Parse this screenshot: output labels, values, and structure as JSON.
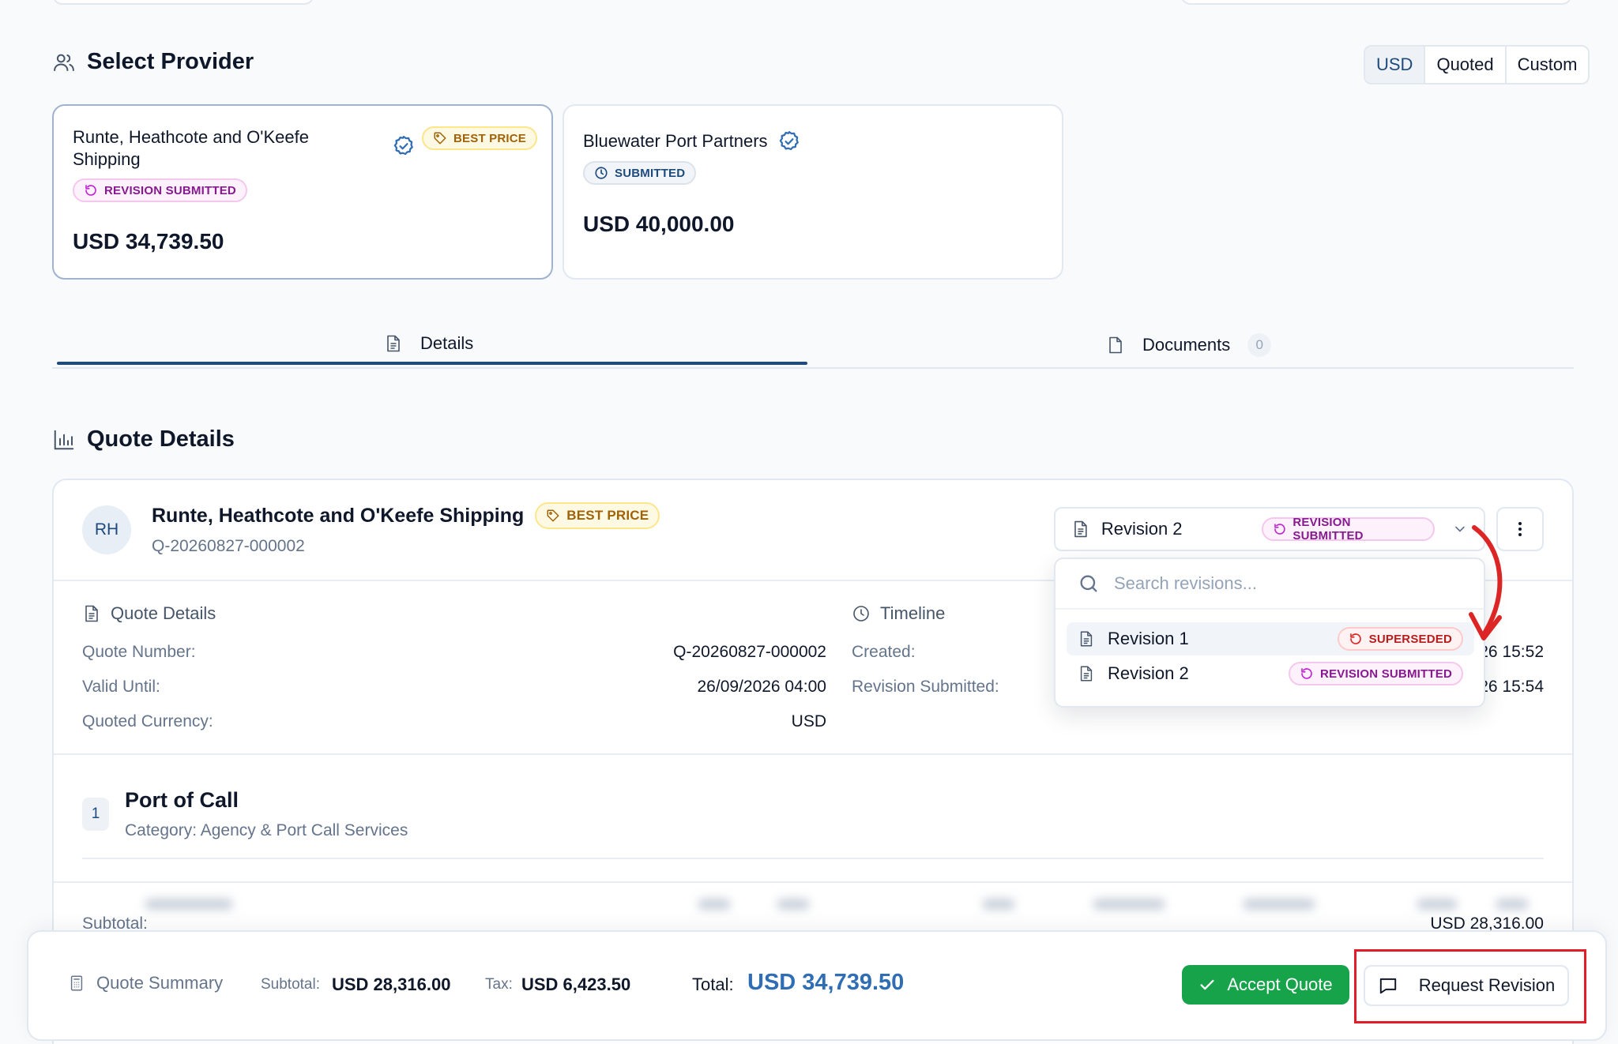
{
  "header": {
    "title": "Select Provider",
    "currency_options": [
      "USD",
      "Quoted",
      "Custom"
    ],
    "currency_selected": "USD"
  },
  "providers": [
    {
      "name_line1": "Runte, Heathcote and O'Keefe",
      "name_line2": "Shipping",
      "badge_best": "BEST PRICE",
      "status": "REVISION SUBMITTED",
      "price": "USD 34,739.50"
    },
    {
      "name": "Bluewater Port Partners",
      "status": "SUBMITTED",
      "price": "USD 40,000.00"
    }
  ],
  "tabs": {
    "details": "Details",
    "documents": "Documents",
    "documents_count": "0"
  },
  "quote_details": {
    "title": "Quote Details",
    "avatar": "RH",
    "provider_name": "Runte, Heathcote and O'Keefe Shipping",
    "best_badge": "BEST PRICE",
    "quote_id": "Q-20260827-000002",
    "section_quote": "Quote Details",
    "section_timeline": "Timeline",
    "rows": [
      {
        "label": "Quote Number:",
        "value": "Q-20260827-000002"
      },
      {
        "label": "Valid Until:",
        "value": "26/09/2026 04:00"
      },
      {
        "label": "Quoted Currency:",
        "value": "USD"
      }
    ],
    "timeline": [
      {
        "label": "Created:",
        "value": "26 15:52"
      },
      {
        "label": "Revision Submitted:",
        "value": "26 15:54"
      }
    ]
  },
  "revision_select": {
    "selected": "Revision 2",
    "selected_status": "REVISION SUBMITTED",
    "search_placeholder": "Search revisions...",
    "items": [
      {
        "label": "Revision 1",
        "status": "SUPERSEDED"
      },
      {
        "label": "Revision 2",
        "status": "REVISION SUBMITTED"
      }
    ]
  },
  "port_of_call": {
    "number": "1",
    "title": "Port of Call",
    "category": "Category: Agency & Port Call Services",
    "subtotal_label": "Subtotal:",
    "subtotal_value": "USD 28,316.00"
  },
  "summary": {
    "title": "Quote Summary",
    "subtotal_label": "Subtotal:",
    "subtotal_value": "USD 28,316.00",
    "tax_label": "Tax:",
    "tax_value": "USD 6,423.50",
    "total_label": "Total:",
    "total_value": "USD 34,739.50",
    "accept_label": "Accept Quote",
    "revision_label": "Request Revision"
  },
  "colors": {
    "primary": "#1e4a7c",
    "accept": "#16a34a",
    "highlight": "#e11d2a"
  }
}
